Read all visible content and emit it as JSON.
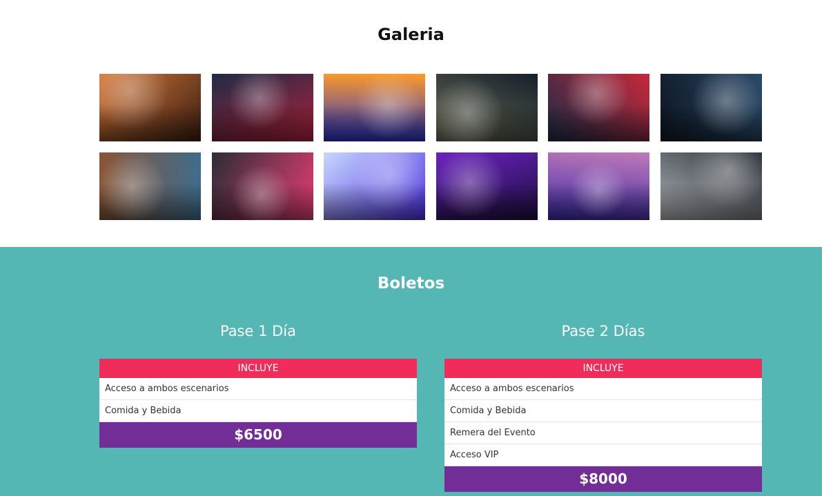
{
  "gallery": {
    "title": "Galeria",
    "photos": [
      {
        "alt": "concert-crowd-photo",
        "c1": "#d87a3a",
        "c2": "#3a1d12"
      },
      {
        "alt": "rock-singer-photo",
        "c1": "#1f2b45",
        "c2": "#b0203a"
      },
      {
        "alt": "festival-lights-photo",
        "c1": "#ff9a28",
        "c2": "#2432c8"
      },
      {
        "alt": "dj-turntable-photo",
        "c1": "#15202a",
        "c2": "#6b6b55"
      },
      {
        "alt": "guitarist-stage-photo",
        "c1": "#c8283b",
        "c2": "#1a2b45"
      },
      {
        "alt": "dj-woman-photo",
        "c1": "#2a4a6a",
        "c2": "#0e1622"
      },
      {
        "alt": "guitar-players-photo",
        "c1": "#3e6d8f",
        "c2": "#8a5434"
      },
      {
        "alt": "dj-booth-photo",
        "c1": "#e23d74",
        "c2": "#2d2d35"
      },
      {
        "alt": "dj-mixer-blue-photo",
        "c1": "#4a2ee0",
        "c2": "#c8d8ff"
      },
      {
        "alt": "dj-controller-purple-photo",
        "c1": "#1c0e3e",
        "c2": "#6b22c0"
      },
      {
        "alt": "band-duo-photo",
        "c1": "#3a2aa8",
        "c2": "#c07ab8"
      },
      {
        "alt": "singer-smoke-photo",
        "c1": "#b0b4b8",
        "c2": "#2a3038"
      }
    ]
  },
  "tickets": {
    "title": "Boletos",
    "passes": [
      {
        "name": "Pase 1 Día",
        "includes_label": "INCLUYE",
        "items": [
          "Acceso a ambos escenarios",
          "Comida y Bebida"
        ],
        "price": "$6500"
      },
      {
        "name": "Pase 2 Días",
        "includes_label": "INCLUYE",
        "items": [
          "Acceso a ambos escenarios",
          "Comida y Bebida",
          "Remera del Evento",
          "Acceso VIP"
        ],
        "price": "$8000"
      }
    ]
  },
  "colors": {
    "section_bg": "#55b7b3",
    "includes_bg": "#f02d5a",
    "price_bg": "#722e96"
  }
}
